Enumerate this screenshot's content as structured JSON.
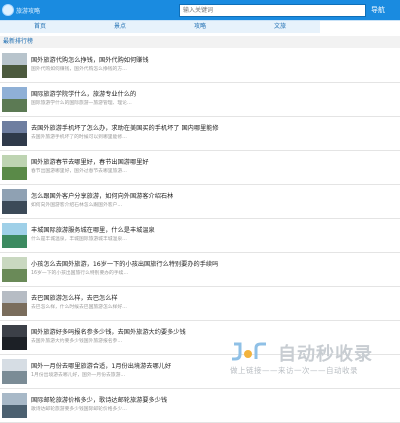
{
  "header": {
    "logo_text": "旅游攻略",
    "search_placeholder": "输入关键词",
    "search_button": "导航",
    "brand_color": "#1a8be0"
  },
  "nav": {
    "items": [
      {
        "label": "首页"
      },
      {
        "label": "景点"
      },
      {
        "label": "攻略"
      },
      {
        "label": "文旅"
      },
      {
        "label": ""
      }
    ]
  },
  "section": {
    "title": "最新排行榜"
  },
  "list": {
    "items": [
      {
        "title": "国外旅游代购怎么挣钱，国外代购如何赚钱",
        "desc": "国外代购如何赚钱，国外代购怎么挣钱的方…",
        "thumb_colors": [
          "#b8c4cc",
          "#4c5a3e"
        ]
      },
      {
        "title": "国际旅游学院学什么，旅游专业什么的",
        "desc": "国际旅游学什么的国际旅游—旅游管理、理论…",
        "thumb_colors": [
          "#8fb0d6",
          "#5c7a54"
        ]
      },
      {
        "title": "去国外旅游手机坏了怎么办，求助在美国买的手机坏了 国内哪里能修",
        "desc": "去国外旅游手机坏了的时候可以到哪里能修…",
        "thumb_colors": [
          "#6e7ea0",
          "#2f3a4a"
        ]
      },
      {
        "title": "国外旅游春节去哪里好，春节出国游哪里好",
        "desc": "春节出国游哪里好，国外过春节去哪里旅游…",
        "thumb_colors": [
          "#bed4b2",
          "#5a8a48"
        ]
      },
      {
        "title": "怎么跟国外客户分享旅游，如何向外国游客介绍石林",
        "desc": "如何向外国游客介绍石林怎么跟国外客户…",
        "thumb_colors": [
          "#8fa1b3",
          "#3c4a58"
        ]
      },
      {
        "title": "丰城国际旅游服务城在哪里，什么是丰城温泉",
        "desc": "什么是丰城温泉，丰城国际旅游城丰城温泉…",
        "thumb_colors": [
          "#9fd0e8",
          "#3c8a60"
        ]
      },
      {
        "title": "小孩怎么去国外旅游，16岁一下的小孩出国旅行么特别要办的手续吗",
        "desc": "16岁一下的小孩出国旅行么特别要办的手续…",
        "thumb_colors": [
          "#c9d8c0",
          "#6a8a58"
        ]
      },
      {
        "title": "去巴国旅游怎么样，去巴怎么样",
        "desc": "去巴怎么样，什么时候去巴国旅游怎么样好…",
        "thumb_colors": [
          "#b6bcc4",
          "#7a6d5c"
        ]
      },
      {
        "title": "国外旅游好多吗报名参多少钱，去国外旅游大约要多少钱",
        "desc": "去国外旅游大约要多少钱国外旅游报名参…",
        "thumb_colors": [
          "#3c4048",
          "#1c2026"
        ]
      },
      {
        "title": "国外一月份去哪里旅游合适，1月份出境游去哪儿好",
        "desc": "1月份出境游去哪儿好，国外一月份去旅游…",
        "thumb_colors": [
          "#d6dde4",
          "#7b8c96"
        ]
      },
      {
        "title": "国际邮轮旅游价格多少，歌诗达邮轮旅游要多少钱",
        "desc": "歌诗达邮轮旅游要多少钱国际邮轮价格多少…",
        "thumb_colors": [
          "#a8b9c8",
          "#4b6070"
        ]
      }
    ]
  },
  "watermark": {
    "text": "自动秒收录",
    "sub": "做上链接——来访一次——自动收录"
  }
}
